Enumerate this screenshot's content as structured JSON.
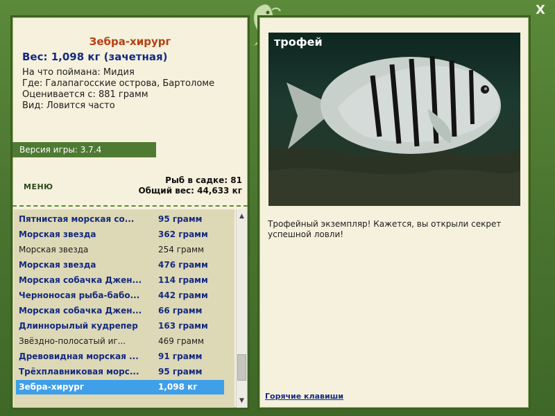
{
  "window": {
    "close_label": "X"
  },
  "fish": {
    "name": "Зебра-хирург",
    "weight_line": "Вес: 1,098 кг (зачетная)",
    "caught_on": "На что поймана: Мидия",
    "location": "Где: Галапагосские острова, Бартоломе",
    "rated_from": "Оценивается с: 881 грамм",
    "frequency": "Вид: Ловится часто"
  },
  "game": {
    "version": "Версия игры: 3.7.4",
    "menu_label": "МЕНЮ"
  },
  "stats": {
    "fish_in_cage": "Рыб в садке: 81",
    "total_weight": "Общий вес: 44,633 кг"
  },
  "catch_list": [
    {
      "name": "Пятнистая морская со...",
      "weight": "95 грамм",
      "trophy": true
    },
    {
      "name": "Морская звезда",
      "weight": "362 грамм",
      "trophy": true
    },
    {
      "name": "Морская звезда",
      "weight": "254 грамм",
      "trophy": false
    },
    {
      "name": "Морская звезда",
      "weight": "476 грамм",
      "trophy": true
    },
    {
      "name": "Морская собачка Джен...",
      "weight": "114 грамм",
      "trophy": true
    },
    {
      "name": "Черноносая рыба-бабо...",
      "weight": "442 грамм",
      "trophy": true
    },
    {
      "name": "Морская собачка Джен...",
      "weight": "66 грамм",
      "trophy": true
    },
    {
      "name": "Длиннорылый кудрепер",
      "weight": "163 грамм",
      "trophy": true
    },
    {
      "name": "Звёздно-полосатый иг...",
      "weight": "469 грамм",
      "trophy": false
    },
    {
      "name": "Древовидная морская ...",
      "weight": "91 грамм",
      "trophy": true
    },
    {
      "name": "Трёхплавниковая морс...",
      "weight": "95 грамм",
      "trophy": true
    },
    {
      "name": "Зебра-хирург",
      "weight": "1,098 кг",
      "trophy": true,
      "selected": true
    }
  ],
  "photo": {
    "label": "трофей"
  },
  "caption": "Трофейный экземпляр! Кажется, вы открыли секрет успешной ловли!",
  "hotkeys_label": "Горячие клавиши",
  "scrollbar": {
    "position": 0.9
  }
}
